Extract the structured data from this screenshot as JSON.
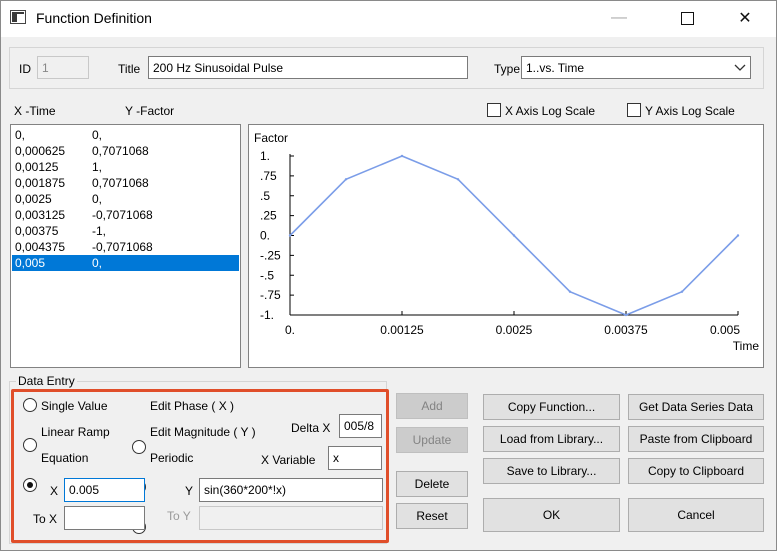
{
  "window": {
    "title": "Function Definition"
  },
  "header": {
    "id_label": "ID",
    "id_value": "1",
    "title_label": "Title",
    "title_value": "200 Hz Sinusoidal Pulse",
    "type_label": "Type",
    "type_value": "1..vs. Time"
  },
  "list": {
    "col_x": "X -Time",
    "col_y": "Y -Factor",
    "rows": [
      {
        "x": "0,",
        "y": "0,"
      },
      {
        "x": "0,000625",
        "y": "0,7071068"
      },
      {
        "x": "0,00125",
        "y": "1,"
      },
      {
        "x": "0,001875",
        "y": "0,7071068"
      },
      {
        "x": "0,0025",
        "y": "0,"
      },
      {
        "x": "0,003125",
        "y": "-0,7071068"
      },
      {
        "x": "0,00375",
        "y": "-1,"
      },
      {
        "x": "0,004375",
        "y": "-0,7071068"
      },
      {
        "x": "0,005",
        "y": "0,"
      }
    ],
    "selected_index": 8
  },
  "options": {
    "x_log_label": "X Axis Log Scale",
    "y_log_label": "Y Axis Log Scale",
    "x_log_checked": false,
    "y_log_checked": false
  },
  "chart_data": {
    "type": "line",
    "ylabel": "Factor",
    "xlabel": "Time",
    "x": [
      0,
      0.000625,
      0.00125,
      0.001875,
      0.0025,
      0.003125,
      0.00375,
      0.004375,
      0.005
    ],
    "series": [
      {
        "values": [
          0,
          0.7071068,
          1,
          0.7071068,
          0,
          -0.7071068,
          -1,
          -0.7071068,
          0
        ]
      }
    ],
    "xlim": [
      0,
      0.005
    ],
    "ylim": [
      -1,
      1
    ],
    "x_ticks": [
      0,
      0.00125,
      0.0025,
      0.00375,
      0.005
    ],
    "x_tick_labels": [
      "0.",
      "0.00125",
      "0.0025",
      "0.00375",
      "0.005"
    ],
    "y_ticks": [
      1,
      0.75,
      0.5,
      0.25,
      0,
      -0.25,
      -0.5,
      -0.75,
      -1
    ],
    "y_tick_labels": [
      "1.",
      ".75",
      ".5",
      ".25",
      "0.",
      "-.25",
      "-.5",
      "-.75",
      "-1."
    ],
    "line_color": "#7b9de8",
    "grid": false
  },
  "data_entry": {
    "group_label": "Data Entry",
    "radio_single": "Single Value",
    "radio_linear": "Linear Ramp",
    "radio_equation": "Equation",
    "radio_phase": "Edit Phase ( X )",
    "radio_magnitude": "Edit Magnitude ( Y )",
    "radio_periodic": "Periodic",
    "selected": "Equation",
    "delta_x_label": "Delta X",
    "delta_x_value": "005/8",
    "x_variable_label": "X Variable",
    "x_variable_value": "x",
    "x_label": "X",
    "x_value": "0.005",
    "y_label": "Y",
    "y_value": "sin(360*200*!x)",
    "to_x_label": "To X",
    "to_x_value": "",
    "to_y_label": "To Y",
    "to_y_value": ""
  },
  "buttons": {
    "add": "Add",
    "update": "Update",
    "delete": "Delete",
    "reset": "Reset",
    "copy_function": "Copy Function...",
    "get_data_series": "Get Data Series Data",
    "load_library": "Load from Library...",
    "paste_clipboard": "Paste from Clipboard",
    "save_library": "Save to Library...",
    "copy_clipboard": "Copy to Clipboard",
    "ok": "OK",
    "cancel": "Cancel"
  },
  "colors": {
    "selection": "#0078d7",
    "highlight_border": "#e04e2a",
    "plot_line": "#7b9de8"
  }
}
